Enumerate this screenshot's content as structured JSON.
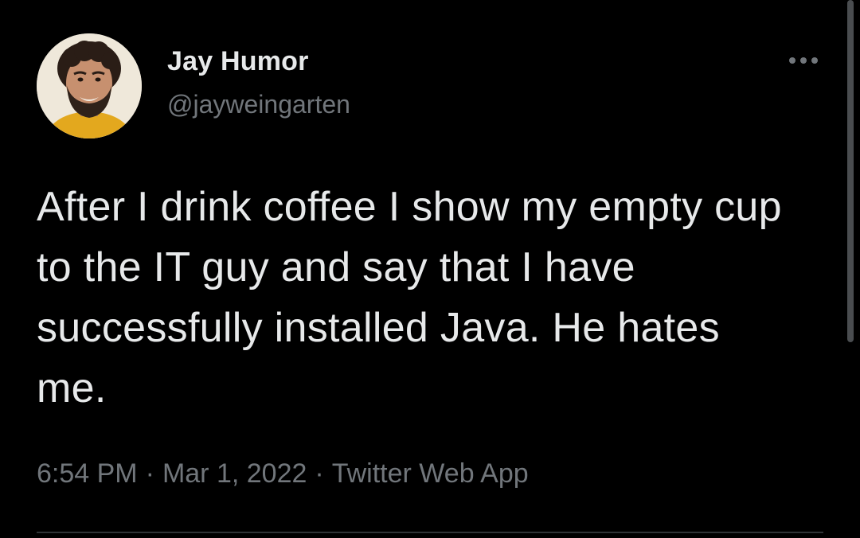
{
  "tweet": {
    "author": {
      "display_name": "Jay Humor",
      "handle": "@jayweingarten"
    },
    "text": "After I drink coffee I show my empty cup to the IT guy and say that I have successfully installed Java. He hates me.",
    "time": "6:54 PM",
    "date": "Mar 1, 2022",
    "separator": "·",
    "source": "Twitter Web App"
  },
  "icons": {
    "more": "more-horizontal-icon",
    "avatar": "profile-photo"
  },
  "colors": {
    "background": "#000000",
    "primary_text": "#e7e9ea",
    "secondary_text": "#71767b",
    "divider": "#2f3336"
  }
}
